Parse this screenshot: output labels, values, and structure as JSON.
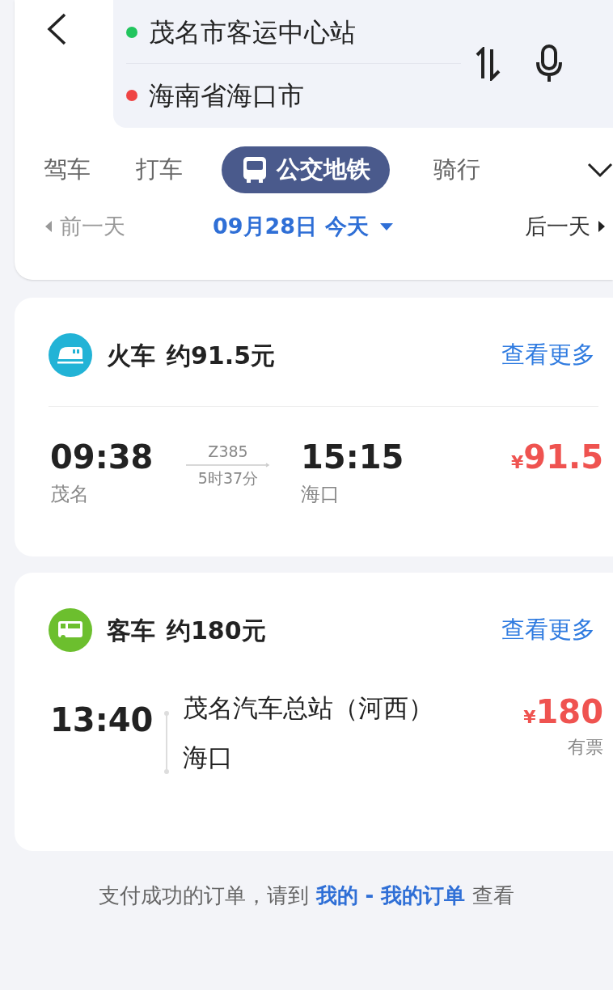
{
  "route": {
    "origin": {
      "name": "茂名市客运中心站",
      "color": "#22c55e"
    },
    "destination": {
      "name": "海南省海口市",
      "color": "#ef4444"
    }
  },
  "tabs": [
    {
      "label": "驾车",
      "selected": false
    },
    {
      "label": "打车",
      "selected": false
    },
    {
      "label": "公交地铁",
      "selected": true
    },
    {
      "label": "骑行",
      "selected": false
    }
  ],
  "date_nav": {
    "previous": "前一天",
    "date": "09月28日 今天",
    "next": "后一天"
  },
  "sections": [
    {
      "kind": "train",
      "title": "火车",
      "estimate": "约91.5元",
      "more": "查看更多",
      "trip": {
        "depart_time": "09:38",
        "depart_station": "茂名",
        "number": "Z385",
        "duration": "5时37分",
        "arrive_time": "15:15",
        "arrive_station": "海口",
        "currency": "¥",
        "price": "91.5"
      }
    },
    {
      "kind": "bus",
      "title": "客车",
      "estimate": "约180元",
      "more": "查看更多",
      "trip": {
        "depart_time": "13:40",
        "from": "茂名汽车总站（河西）",
        "to": "海口",
        "currency": "¥",
        "price": "180",
        "availability": "有票"
      }
    }
  ],
  "footer": {
    "prefix": "支付成功的订单，请到 ",
    "link": "我的 - 我的订单",
    "suffix": " 查看"
  }
}
